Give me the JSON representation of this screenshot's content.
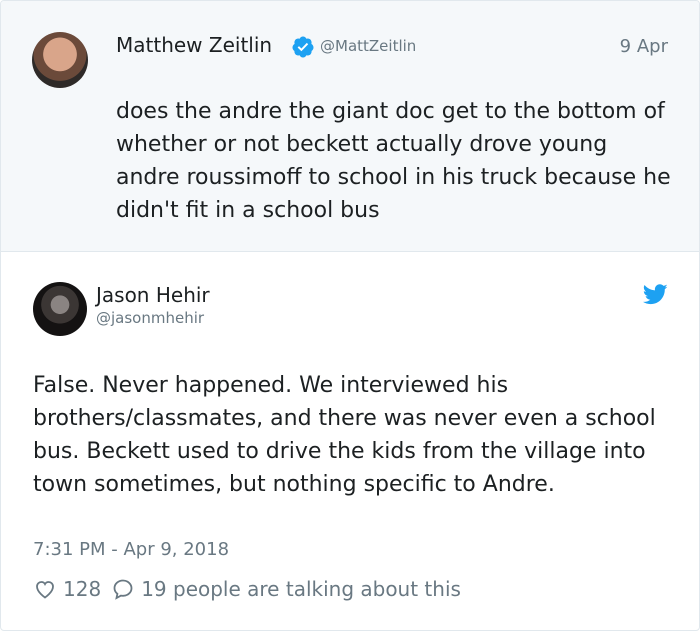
{
  "quoted_tweet": {
    "author_name": "Matthew Zeitlin",
    "author_handle": "@MattZeitlin",
    "verified_icon": "verified-badge-icon",
    "date": "9 Apr",
    "text": "does the andre the giant doc get to the bottom of whether or not beckett actually drove young andre roussimoff to school in his truck because he didn't fit in a school bus"
  },
  "tweet": {
    "author_name": "Jason Hehir",
    "author_handle": "@jasonmhehir",
    "platform_icon": "twitter-bird-icon",
    "text": "False. Never happened. We interviewed his brothers/classmates, and there was never even a school bus. Beckett used to drive the kids from the village into town sometimes, but nothing specific to Andre.",
    "timestamp": "7:31 PM - Apr 9, 2018",
    "likes": "128",
    "conversation": "19 people are talking about this"
  },
  "colors": {
    "accent": "#1da1f2",
    "muted_text": "#697882",
    "quoted_background": "#f5f8fa",
    "border": "#e1e8ed"
  }
}
